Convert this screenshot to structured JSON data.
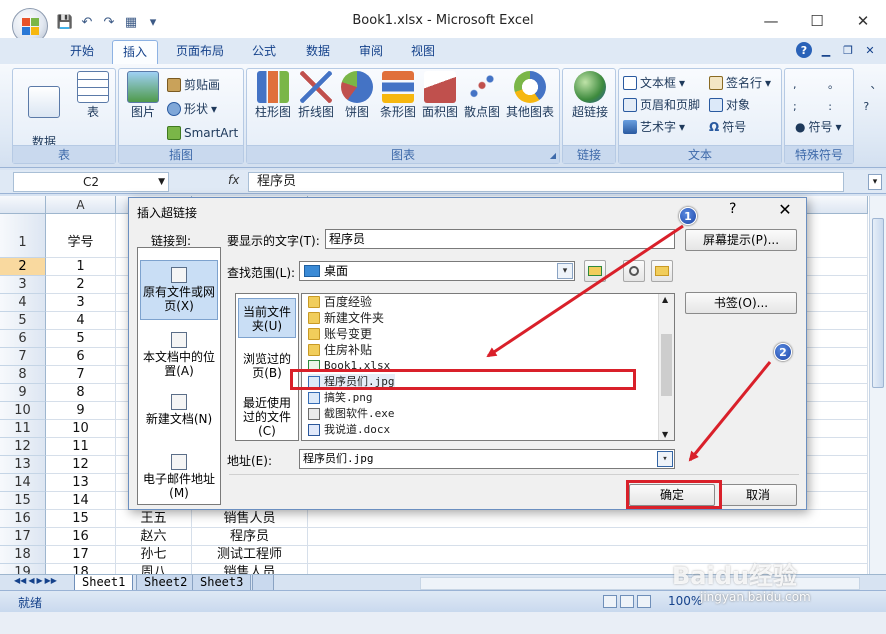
{
  "window": {
    "title": "Book1.xlsx - Microsoft Excel",
    "controls": {
      "minimize": "—",
      "maximize": "☐",
      "close": "✕"
    }
  },
  "qat": {
    "save": "💾",
    "undo": "↶",
    "redo": "↷",
    "extra": "▦",
    "more": "▾"
  },
  "tabs": [
    "开始",
    "插入",
    "页面布局",
    "公式",
    "数据",
    "审阅",
    "视图"
  ],
  "active_tab": "插入",
  "ribbon": {
    "groups": {
      "table": {
        "label": "表",
        "pivot": "数据\n透视表",
        "pivot_arrow": "▾",
        "table": "表"
      },
      "illustrations": {
        "label": "插图",
        "picture": "图片",
        "clipart": "剪贴画",
        "shapes": "形状",
        "smartart": "SmartArt"
      },
      "charts": {
        "label": "图表",
        "items": [
          "柱形图",
          "折线图",
          "饼图",
          "条形图",
          "面积图",
          "散点图",
          "其他图表"
        ],
        "launcher": "◢"
      },
      "links": {
        "label": "链接",
        "hyperlink": "超链接"
      },
      "text": {
        "label": "文本",
        "textbox": "文本框",
        "header_footer": "页眉和页脚",
        "wordart": "艺术字",
        "signature": "签名行",
        "object": "对象",
        "symbol": "符号"
      },
      "special": {
        "label": "特殊符号",
        "symbol": "符号"
      }
    }
  },
  "formula_bar": {
    "name_box": "C2",
    "fx": "fx",
    "value": "程序员"
  },
  "sheet": {
    "column_header": "A",
    "header_cell": "学号",
    "rows": [
      {
        "n": "1",
        "a": "学号"
      },
      {
        "n": "2",
        "a": "1"
      },
      {
        "n": "3",
        "a": "2"
      },
      {
        "n": "4",
        "a": "3"
      },
      {
        "n": "5",
        "a": "4"
      },
      {
        "n": "6",
        "a": "5"
      },
      {
        "n": "7",
        "a": "6"
      },
      {
        "n": "8",
        "a": "7"
      },
      {
        "n": "9",
        "a": "8"
      },
      {
        "n": "10",
        "a": "9"
      },
      {
        "n": "11",
        "a": "10"
      },
      {
        "n": "12",
        "a": "11"
      },
      {
        "n": "13",
        "a": "12"
      },
      {
        "n": "14",
        "a": "13"
      },
      {
        "n": "15",
        "a": "14"
      },
      {
        "n": "16",
        "a": "15",
        "b": "王五",
        "c": "销售人员"
      },
      {
        "n": "17",
        "a": "16",
        "b": "赵六",
        "c": "程序员"
      },
      {
        "n": "18",
        "a": "17",
        "b": "孙七",
        "c": "测试工程师"
      },
      {
        "n": "19",
        "a": "18",
        "b": "周八",
        "c": "销售人员"
      }
    ]
  },
  "sheet_tabs": [
    "Sheet1",
    "Sheet2",
    "Sheet3"
  ],
  "status": {
    "ready": "就绪",
    "zoom": "100%"
  },
  "dialog": {
    "title": "插入超链接",
    "help": "?",
    "close": "✕",
    "link_to": "链接到:",
    "link_items": [
      "原有文件或网页(X)",
      "本文档中的位置(A)",
      "新建文档(N)",
      "电子邮件地址(M)"
    ],
    "display_text_label": "要显示的文字(T):",
    "display_text_value": "程序员",
    "screen_tip": "屏幕提示(P)...",
    "look_in_label": "查找范围(L):",
    "look_in_value": "桌面",
    "bookmark": "书签(O)...",
    "side_nav": [
      "当前文件夹(U)",
      "浏览过的页(B)",
      "最近使用过的文件(C)"
    ],
    "files": [
      {
        "name": "百度经验",
        "type": "folder"
      },
      {
        "name": "新建文件夹",
        "type": "folder"
      },
      {
        "name": "账号变更",
        "type": "folder"
      },
      {
        "name": "住房补贴",
        "type": "folder"
      },
      {
        "name": "Book1.xlsx",
        "type": "xls"
      },
      {
        "name": "程序员们.jpg",
        "type": "img"
      },
      {
        "name": "搞笑.png",
        "type": "img"
      },
      {
        "name": "截图软件.exe",
        "type": "exe"
      },
      {
        "name": "我说道.docx",
        "type": "doc"
      }
    ],
    "address_label": "地址(E):",
    "address_value": "程序员们.jpg",
    "ok": "确定",
    "cancel": "取消"
  },
  "annotations": {
    "badge1": "1",
    "badge2": "2",
    "arrow_color": "#d9202a"
  },
  "watermark": {
    "brand": "Baidu经验",
    "url": "jingyan.baidu.com"
  }
}
